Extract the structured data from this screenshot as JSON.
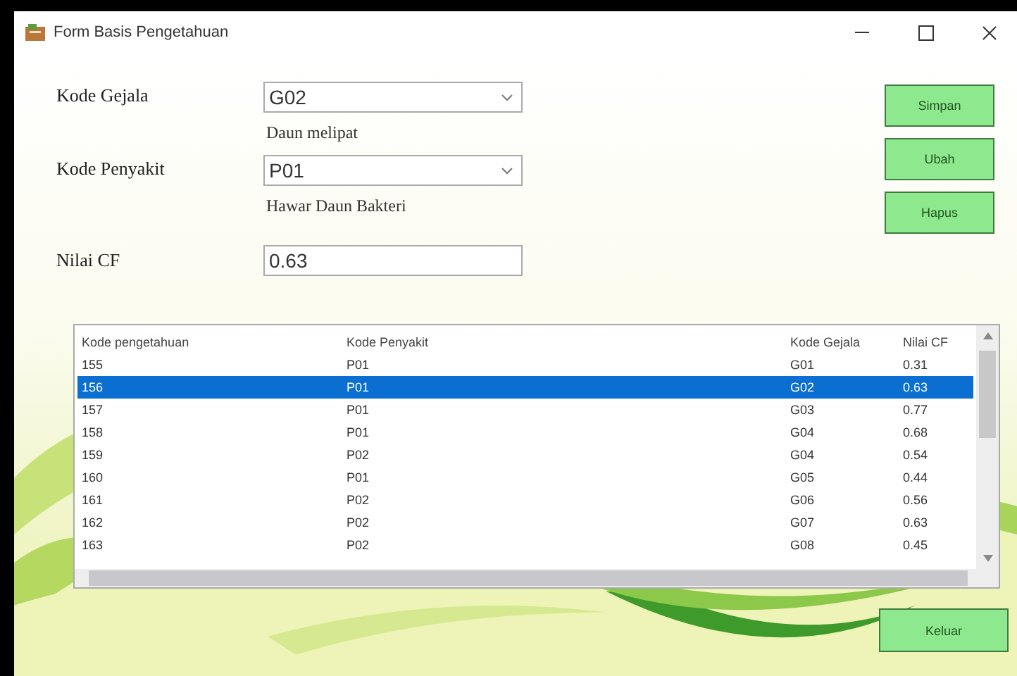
{
  "window": {
    "title": "Form Basis Pengetahuan"
  },
  "form": {
    "fields": [
      {
        "label": "Kode Gejala",
        "kind": "combo",
        "value": "G02",
        "caption": "Daun melipat"
      },
      {
        "label": "Kode Penyakit",
        "kind": "combo",
        "value": "P01",
        "caption": "Hawar Daun Bakteri"
      },
      {
        "label": "Nilai CF",
        "kind": "text",
        "value": "0.63"
      }
    ]
  },
  "buttons": [
    "Simpan",
    "Ubah",
    "Hapus"
  ],
  "table": {
    "columns": [
      "Kode pengetahuan",
      "Kode Penyakit",
      "Kode Gejala",
      "Nilai CF"
    ],
    "rows": [
      {
        "cells": [
          "155",
          "P01",
          "G01",
          "0.31"
        ],
        "selected": false
      },
      {
        "cells": [
          "156",
          "P01",
          "G02",
          "0.63"
        ],
        "selected": true
      },
      {
        "cells": [
          "157",
          "P01",
          "G03",
          "0.77"
        ],
        "selected": false
      },
      {
        "cells": [
          "158",
          "P01",
          "G04",
          "0.68"
        ],
        "selected": false
      },
      {
        "cells": [
          "159",
          "P02",
          "G04",
          "0.54"
        ],
        "selected": false
      },
      {
        "cells": [
          "160",
          "P01",
          "G05",
          "0.44"
        ],
        "selected": false
      },
      {
        "cells": [
          "161",
          "P02",
          "G06",
          "0.56"
        ],
        "selected": false
      },
      {
        "cells": [
          "162",
          "P02",
          "G07",
          "0.63"
        ],
        "selected": false
      },
      {
        "cells": [
          "163",
          "P02",
          "G08",
          "0.45"
        ],
        "selected": false
      }
    ]
  },
  "footer_button": "Keluar"
}
